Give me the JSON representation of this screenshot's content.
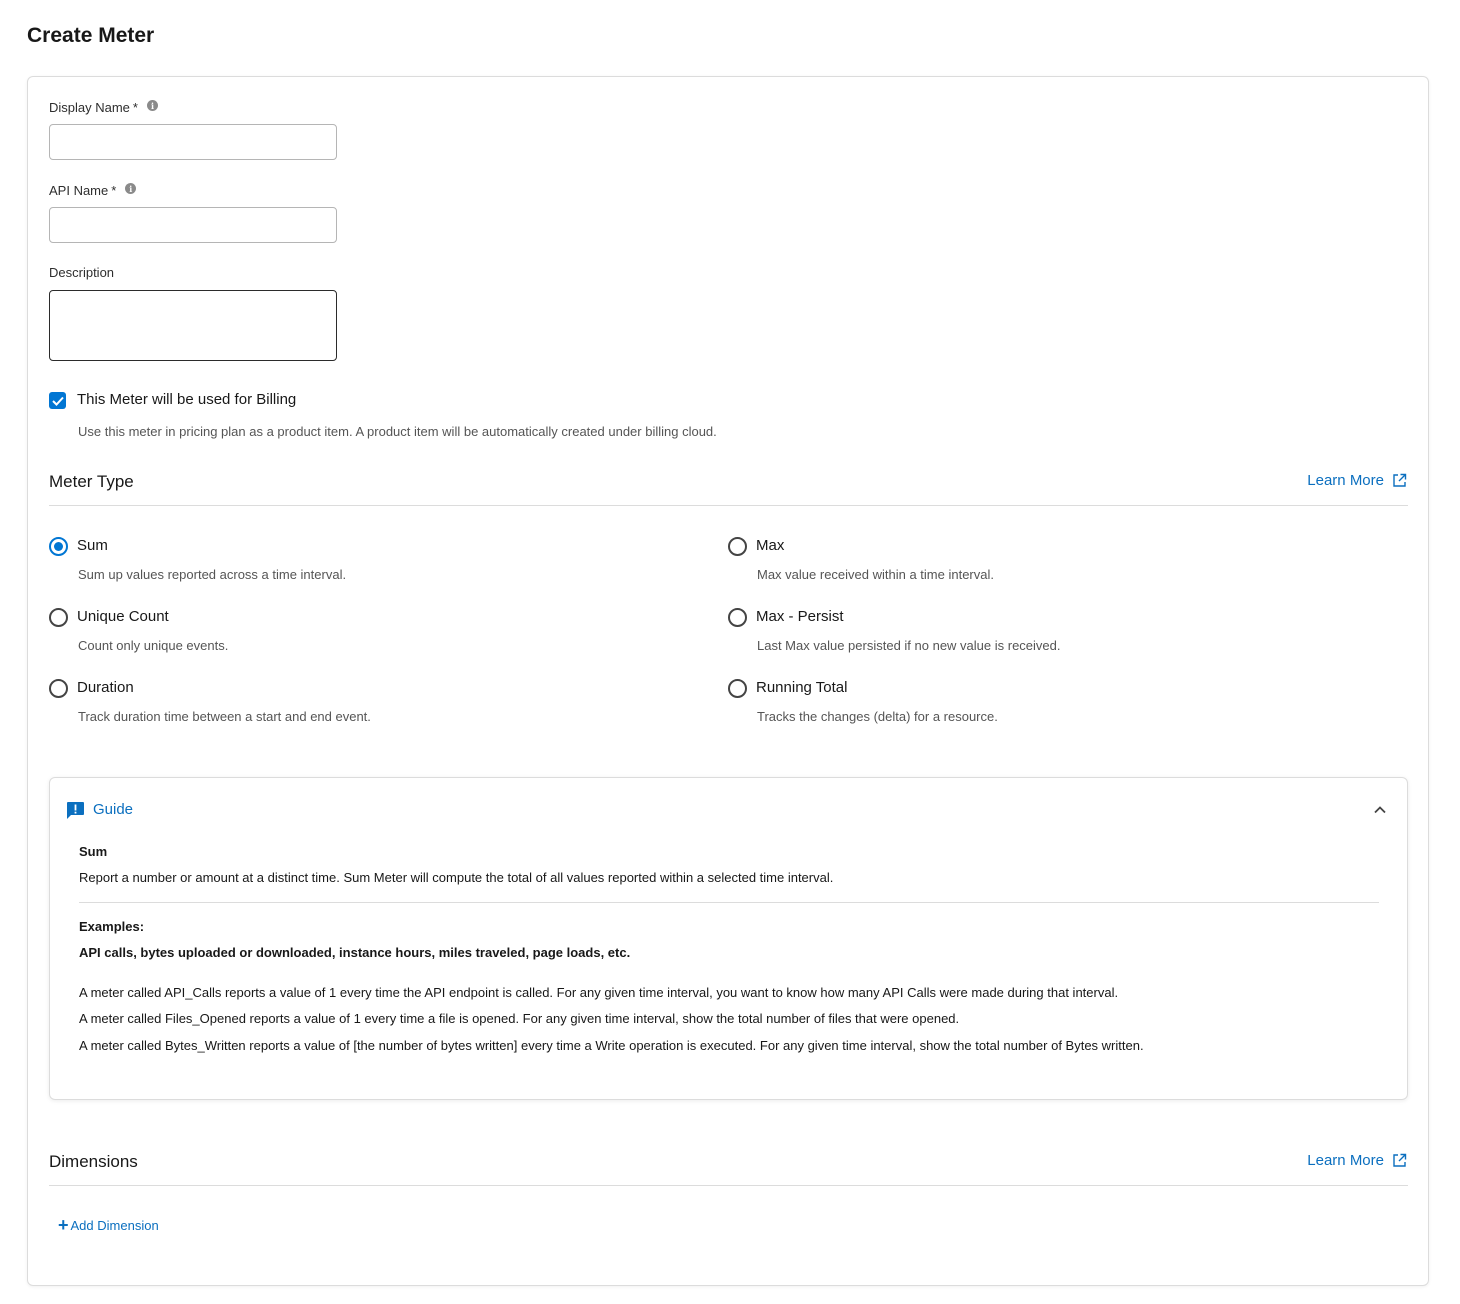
{
  "page": {
    "title": "Create Meter"
  },
  "form": {
    "display_name": {
      "label": "Display Name",
      "required_mark": "*",
      "value": "",
      "placeholder": ""
    },
    "api_name": {
      "label": "API Name",
      "required_mark": "*",
      "value": "",
      "placeholder": ""
    },
    "description": {
      "label": "Description",
      "value": ""
    },
    "billing": {
      "checked": true,
      "label": "This Meter will be used for Billing",
      "help": "Use this meter in pricing plan as a product item. A product item will be automatically created under billing cloud."
    }
  },
  "meter_type": {
    "title": "Meter Type",
    "learn_more": "Learn More",
    "selected": "Sum",
    "options": [
      {
        "label": "Sum",
        "desc": "Sum up values reported across a time interval."
      },
      {
        "label": "Max",
        "desc": "Max value received within a time interval."
      },
      {
        "label": "Unique Count",
        "desc": "Count only unique events."
      },
      {
        "label": "Max - Persist",
        "desc": "Last Max value persisted if no new value is received."
      },
      {
        "label": "Duration",
        "desc": "Track duration time between a start and end event."
      },
      {
        "label": "Running Total",
        "desc": "Tracks the changes (delta) for a resource."
      }
    ]
  },
  "guide": {
    "title": "Guide",
    "expanded": true,
    "heading": "Sum",
    "summary": "Report a number or amount at a distinct time. Sum Meter will compute the total of all values reported within a selected time interval.",
    "examples_label": "Examples:",
    "examples_list": "API calls, bytes uploaded or downloaded, instance hours, miles traveled, page loads, etc.",
    "lines": [
      "A meter called API_Calls reports a value of 1 every time the API endpoint is called. For any given time interval, you want to know how many API Calls were made during that interval.",
      "A meter called Files_Opened reports a value of 1 every time a file is opened. For any given time interval, show the total number of files that were opened.",
      "A meter called Bytes_Written reports a value of [the number of bytes written] every time a Write operation is executed. For any given time interval, show the total number of Bytes written."
    ]
  },
  "dimensions": {
    "title": "Dimensions",
    "learn_more": "Learn More",
    "add_label": "Add Dimension"
  },
  "colors": {
    "accent": "#0176d3",
    "link": "#0b6fbf",
    "border": "#dcdcdc"
  },
  "icons": {
    "info": "info-icon",
    "external": "external-link-icon",
    "guide": "feedback-icon",
    "collapse": "chevron-up-icon",
    "add": "plus-icon",
    "check": "check-icon"
  }
}
